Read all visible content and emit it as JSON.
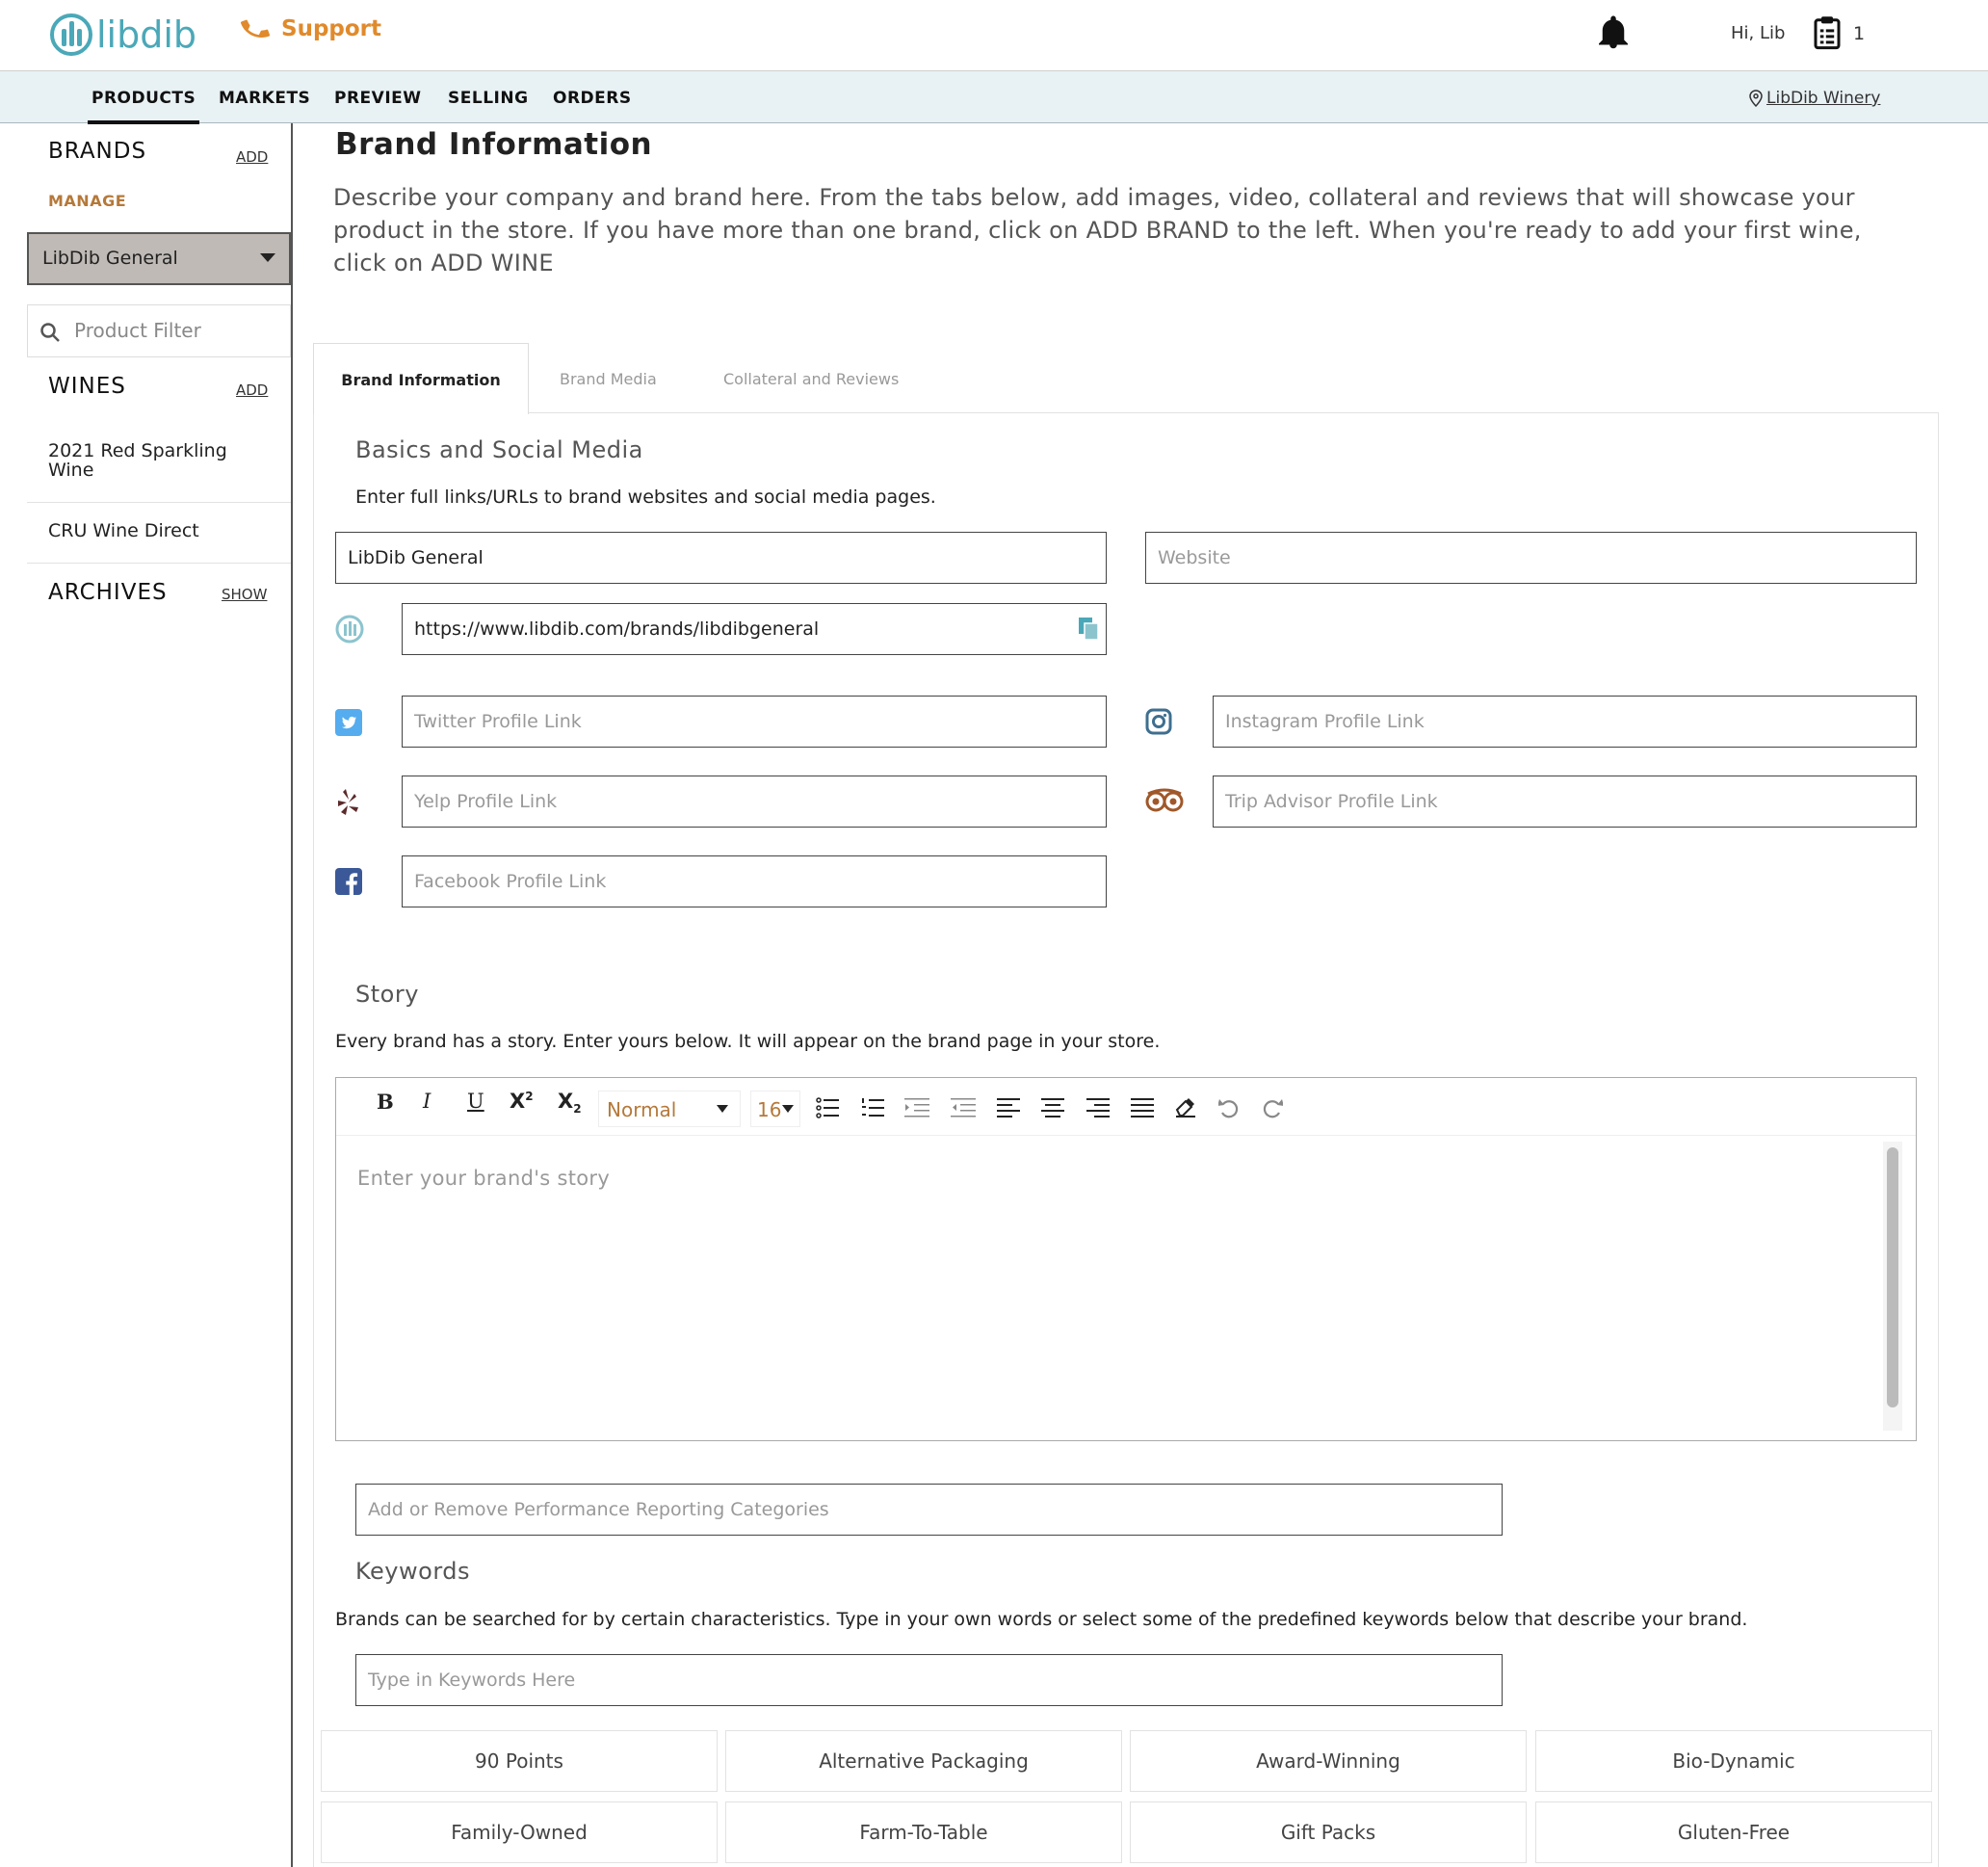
{
  "header": {
    "logo_text": "libdib",
    "support_label": "Support",
    "greeting": "Hi, Lib",
    "cart_count": "1"
  },
  "nav": {
    "items": [
      "PRODUCTS",
      "MARKETS",
      "PREVIEW",
      "SELLING",
      "ORDERS"
    ],
    "active": "PRODUCTS",
    "winery_label": "LibDib Winery"
  },
  "sidebar": {
    "brands_heading": "BRANDS",
    "brands_add": "ADD",
    "manage_label": "MANAGE",
    "selected_brand": "LibDib General",
    "filter_placeholder": "Product Filter",
    "wines_heading": "WINES",
    "wines_add": "ADD",
    "wines": [
      "2021 Red Sparkling Wine",
      "CRU Wine Direct"
    ],
    "archives_heading": "ARCHIVES",
    "archives_show": "SHOW"
  },
  "main": {
    "title": "Brand Information",
    "description": "Describe your company and brand here. From the tabs below, add images, video, collateral and reviews that will showcase your product in the store. If you have more than one brand, click on ADD BRAND to the left. When you're ready to add your first wine, click on ADD WINE",
    "tabs": [
      "Brand Information",
      "Brand Media",
      "Collateral and Reviews"
    ],
    "active_tab": "Brand Information"
  },
  "basics": {
    "title": "Basics and Social Media",
    "subtitle": "Enter full links/URLs to brand websites and social media pages.",
    "brand_name_value": "LibDib General",
    "website_placeholder": "Website",
    "libdib_url_value": "https://www.libdib.com/brands/libdibgeneral",
    "twitter_placeholder": "Twitter Profile Link",
    "instagram_placeholder": "Instagram Profile Link",
    "yelp_placeholder": "Yelp Profile Link",
    "tripadvisor_placeholder": "Trip Advisor Profile Link",
    "facebook_placeholder": "Facebook Profile Link"
  },
  "story": {
    "title": "Story",
    "subtitle": "Every brand has a story. Enter yours below. It will appear on the brand page in your store.",
    "format_value": "Normal",
    "font_size_value": "16",
    "placeholder": "Enter your brand's story"
  },
  "performance": {
    "placeholder": "Add or Remove Performance Reporting Categories"
  },
  "keywords": {
    "title": "Keywords",
    "subtitle": "Brands can be searched for by certain characteristics. Type in your own words or select some of the predefined keywords below that describe your brand.",
    "input_placeholder": "Type in Keywords Here",
    "options": [
      "90 Points",
      "Alternative Packaging",
      "Award-Winning",
      "Bio-Dynamic",
      "Family-Owned",
      "Farm-To-Table",
      "Gift Packs",
      "Gluten-Free"
    ]
  },
  "colors": {
    "brand_teal": "#4ba8b8",
    "accent_orange": "#e08a2c",
    "manage_brown": "#b5793a",
    "nav_bg": "#e8f1f4",
    "twitter_blue": "#55acee",
    "facebook_blue": "#3b5998",
    "yelp_red": "#5c2a2a",
    "tripadvisor_brown": "#a0582a"
  }
}
